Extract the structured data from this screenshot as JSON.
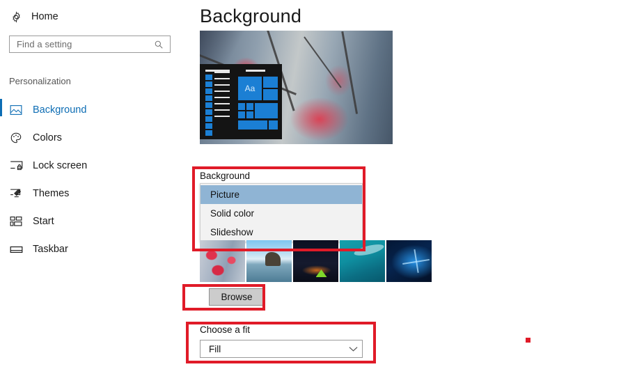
{
  "sidebar": {
    "home": {
      "label": "Home",
      "icon": "gear-icon"
    },
    "search": {
      "placeholder": "Find a setting",
      "value": "",
      "icon": "search-icon"
    },
    "section_header": "Personalization",
    "items": [
      {
        "label": "Background",
        "icon": "picture-icon",
        "selected": true
      },
      {
        "label": "Colors",
        "icon": "palette-icon",
        "selected": false
      },
      {
        "label": "Lock screen",
        "icon": "lock-screen-icon",
        "selected": false
      },
      {
        "label": "Themes",
        "icon": "themes-brush-icon",
        "selected": false
      },
      {
        "label": "Start",
        "icon": "start-tiles-icon",
        "selected": false
      },
      {
        "label": "Taskbar",
        "icon": "taskbar-icon",
        "selected": false
      }
    ]
  },
  "main": {
    "title": "Background",
    "preview": {
      "tile_text": "Aa",
      "alt": "desktop-preview-autumn-branch"
    },
    "background_label": "Background",
    "dropdown_options": [
      {
        "label": "Picture",
        "highlighted": true
      },
      {
        "label": "Solid color",
        "highlighted": false
      },
      {
        "label": "Slideshow",
        "highlighted": false
      }
    ],
    "thumbnails": [
      {
        "name": "red-maple-leaves"
      },
      {
        "name": "beach-rock-reflection"
      },
      {
        "name": "night-camping-tent"
      },
      {
        "name": "teal-underwater-wave"
      },
      {
        "name": "windows-10-blue-logo"
      }
    ],
    "browse_label": "Browse",
    "fit_label": "Choose a fit",
    "fit_value": "Fill",
    "fit_chevron_icon": "chevron-down-icon"
  },
  "annotations": {
    "accent_color": "#e01b28",
    "boxes": [
      {
        "name": "background-dropdown-highlight"
      },
      {
        "name": "browse-button-highlight"
      },
      {
        "name": "choose-a-fit-highlight"
      }
    ],
    "dot": {
      "name": "red-dot-marker"
    }
  },
  "colors": {
    "accent_blue": "#0d6db4",
    "highlight_row": "#8fb4d4",
    "annotation_red": "#e01b28"
  }
}
